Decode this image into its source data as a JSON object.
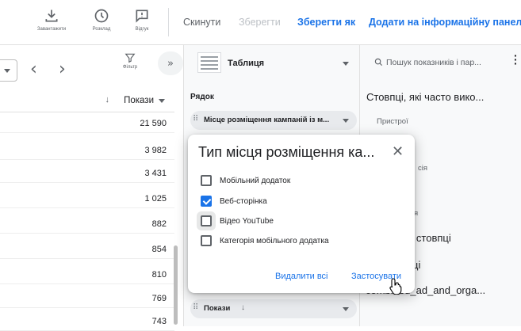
{
  "toolbar": {
    "download_label": "Завантажити",
    "schedule_label": "Розклад",
    "feedback_label": "Відгук",
    "reset_label": "Скинути",
    "save_label": "Зберегти",
    "save_as_label": "Зберегти як",
    "add_dashboard_label": "Додати на інформаційну панель",
    "accent_color": "#1a73e8"
  },
  "left": {
    "filter_label": "Фільтр",
    "column_header": "Покази",
    "rows": [
      "21 590",
      "3 982",
      "3 431",
      "1 025",
      "882",
      "854",
      "810",
      "769",
      "743"
    ]
  },
  "config": {
    "visualization": "Таблиця",
    "row_section": "Рядок",
    "row_chip": "Місце розміщення кампаній із м...",
    "metric_chip": "Покази"
  },
  "right": {
    "search_placeholder": "Пошук показників і пар...",
    "frequent_title": "Стовпці, які часто вико...",
    "devices": "Пристрої",
    "faded_1": "сія",
    "faded_2": "я",
    "other_columns": "ші стовпці",
    "small_text": "ці",
    "metric_name": "combined_ad_and_orga..."
  },
  "dialog": {
    "title": "Тип місця розміщення ка...",
    "options": [
      {
        "label": "Мобільний додаток",
        "checked": false
      },
      {
        "label": "Веб-сторінка",
        "checked": true
      },
      {
        "label": "Відео YouTube",
        "checked": false
      },
      {
        "label": "Категорія мобільного додатка",
        "checked": false
      }
    ],
    "clear_label": "Видалити всі",
    "apply_label": "Застосувати"
  }
}
